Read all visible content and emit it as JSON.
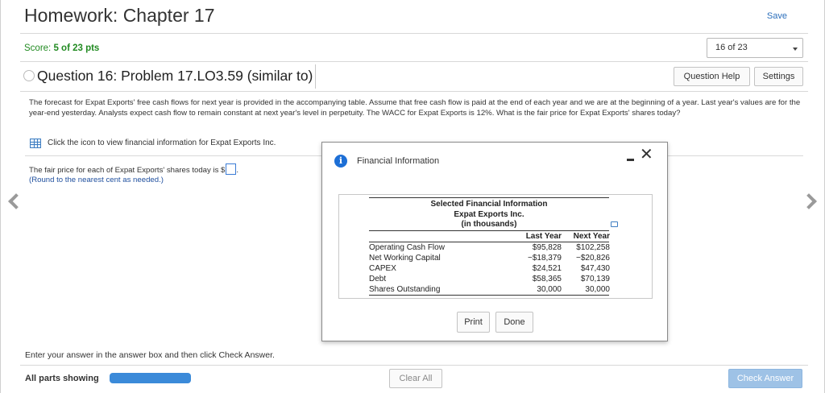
{
  "header": {
    "title": "Homework: Chapter 17",
    "save_label": "Save"
  },
  "score": {
    "label": "Score:",
    "value": "5 of 23 pts"
  },
  "question_select": {
    "selected": "16 of 23"
  },
  "question": {
    "title": "Question 16: Problem 17.LO3.59 (similar to)",
    "help_label": "Question Help",
    "settings_label": "Settings",
    "prompt": "The forecast for Expat Exports' free cash flows for next year is provided in the accompanying table. Assume that free cash flow is paid at the end of each year and we are at the beginning of a year. Last year's values are for the year-end yesterday. Analysts expect cash flow to remain constant at next year's level in perpetuity. The WACC for Expat Exports is 12%. What is the fair price for Expat Exports' shares today?",
    "tool_text": "Click the icon to view financial information for Expat Exports Inc.",
    "answer_prefix": "The fair price for each of Expat Exports' shares today is $",
    "answer_suffix": ".",
    "round_note": "(Round to the nearest cent as needed.)"
  },
  "modal": {
    "title": "Financial Information",
    "table_title": "Selected Financial Information",
    "company": "Expat Exports Inc.",
    "units": "(in thousands)",
    "columns": [
      "Last Year",
      "Next Year"
    ],
    "rows": [
      {
        "label": "Operating Cash Flow",
        "last": "$95,828",
        "next": "$102,258"
      },
      {
        "label": "Net Working Capital",
        "last": "−$18,379",
        "next": "−$20,826"
      },
      {
        "label": "CAPEX",
        "last": "$24,521",
        "next": "$47,430"
      },
      {
        "label": "Debt",
        "last": "$58,365",
        "next": "$70,139"
      },
      {
        "label": "Shares Outstanding",
        "last": "30,000",
        "next": "30,000"
      }
    ],
    "print_label": "Print",
    "done_label": "Done"
  },
  "footer": {
    "instruction": "Enter your answer in the answer box and then click Check Answer.",
    "all_parts": "All parts showing",
    "progress": 1.0,
    "clear_label": "Clear All",
    "check_label": "Check Answer"
  },
  "colors": {
    "score_green": "#228b22",
    "link_blue": "#2a6ebb",
    "progress_blue": "#3b8ad9",
    "check_button": "#9ec2e6",
    "info_icon": "#1d6fd6"
  },
  "icons": [
    "info-icon",
    "close-icon",
    "minimize-icon",
    "table-icon",
    "copy-icon",
    "chevron-left-icon",
    "chevron-right-icon"
  ]
}
